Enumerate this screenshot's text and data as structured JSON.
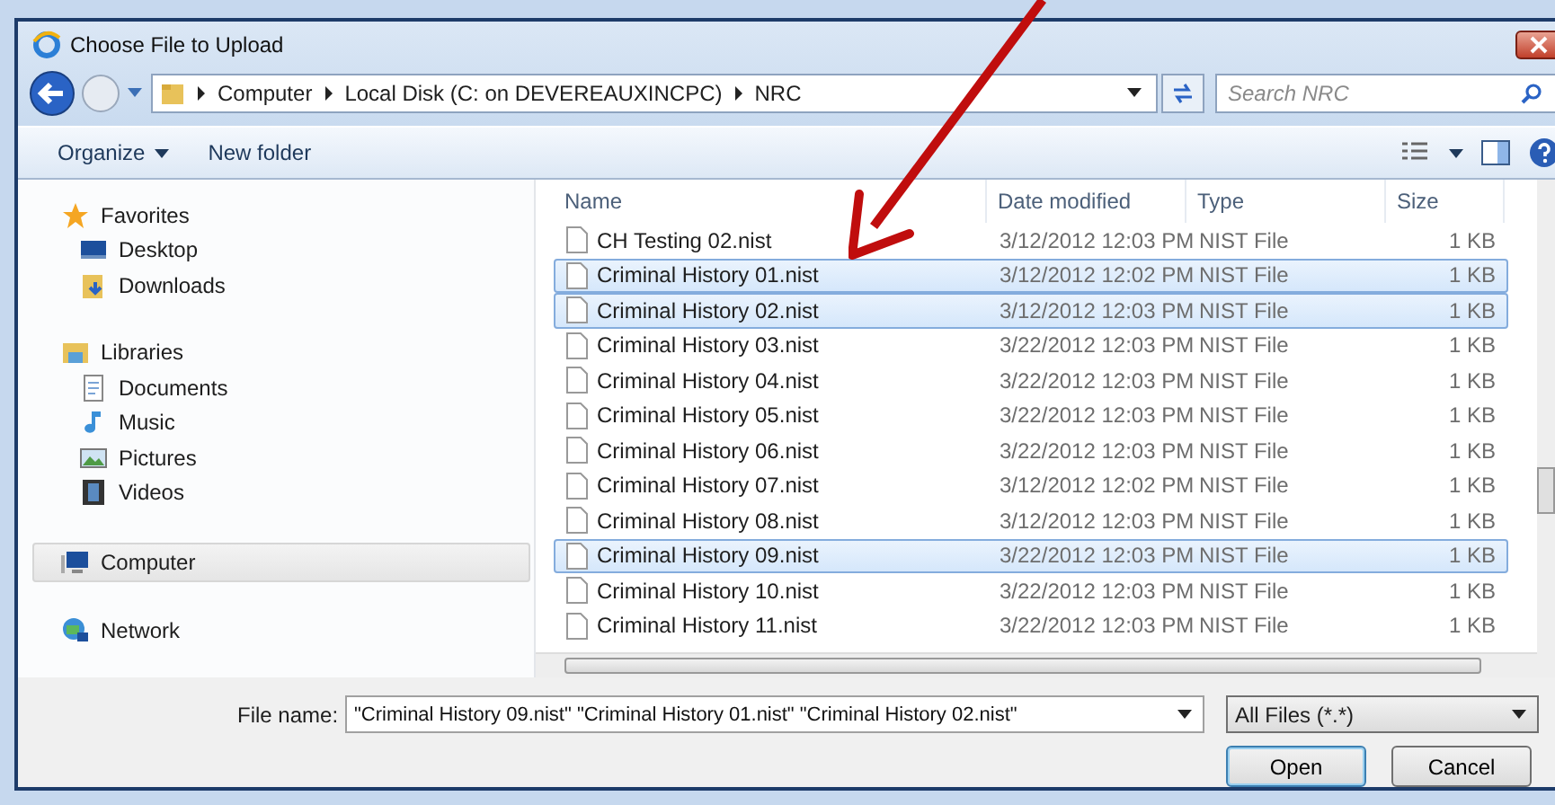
{
  "window": {
    "title": "Choose File to Upload"
  },
  "address_bar": {
    "path": [
      "Computer",
      "Local Disk (C: on DEVEREAUXINCPC)",
      "NRC"
    ]
  },
  "search": {
    "placeholder": "Search NRC"
  },
  "toolbar": {
    "organize": "Organize",
    "new_folder": "New folder"
  },
  "sidebar": {
    "sections": [
      {
        "label": "Favorites",
        "kind": "favorites",
        "selected": false,
        "items": [
          {
            "label": "Desktop",
            "kind": "desktop"
          },
          {
            "label": "Downloads",
            "kind": "downloads"
          }
        ]
      },
      {
        "label": "Libraries",
        "kind": "libraries",
        "selected": false,
        "items": [
          {
            "label": "Documents",
            "kind": "documents"
          },
          {
            "label": "Music",
            "kind": "music"
          },
          {
            "label": "Pictures",
            "kind": "pictures"
          },
          {
            "label": "Videos",
            "kind": "videos"
          }
        ]
      },
      {
        "label": "Computer",
        "kind": "computer",
        "selected": true
      },
      {
        "label": "Network",
        "kind": "network",
        "selected": false
      }
    ]
  },
  "table": {
    "columns": [
      "Name",
      "Date modified",
      "Type",
      "Size"
    ],
    "rows": [
      {
        "name": "CH Testing  02.nist",
        "date": "3/12/2012 12:03 PM",
        "type": "NIST File",
        "size": "1 KB",
        "selected": false
      },
      {
        "name": "Criminal History 01.nist",
        "date": "3/12/2012 12:02 PM",
        "type": "NIST File",
        "size": "1 KB",
        "selected": true
      },
      {
        "name": "Criminal History 02.nist",
        "date": "3/12/2012 12:03 PM",
        "type": "NIST File",
        "size": "1 KB",
        "selected": true
      },
      {
        "name": "Criminal History 03.nist",
        "date": "3/22/2012 12:03 PM",
        "type": "NIST File",
        "size": "1 KB",
        "selected": false
      },
      {
        "name": "Criminal History 04.nist",
        "date": "3/22/2012 12:03 PM",
        "type": "NIST File",
        "size": "1 KB",
        "selected": false
      },
      {
        "name": "Criminal History 05.nist",
        "date": "3/22/2012 12:03 PM",
        "type": "NIST File",
        "size": "1 KB",
        "selected": false
      },
      {
        "name": "Criminal History 06.nist",
        "date": "3/22/2012 12:03 PM",
        "type": "NIST File",
        "size": "1 KB",
        "selected": false
      },
      {
        "name": "Criminal History 07.nist",
        "date": "3/12/2012 12:02 PM",
        "type": "NIST File",
        "size": "1 KB",
        "selected": false
      },
      {
        "name": "Criminal History 08.nist",
        "date": "3/12/2012 12:03 PM",
        "type": "NIST File",
        "size": "1 KB",
        "selected": false
      },
      {
        "name": "Criminal History 09.nist",
        "date": "3/22/2012 12:03 PM",
        "type": "NIST File",
        "size": "1 KB",
        "selected": true
      },
      {
        "name": "Criminal History 10.nist",
        "date": "3/22/2012 12:03 PM",
        "type": "NIST File",
        "size": "1 KB",
        "selected": false
      },
      {
        "name": "Criminal History 11.nist",
        "date": "3/22/2012 12:03 PM",
        "type": "NIST File",
        "size": "1 KB",
        "selected": false
      }
    ]
  },
  "file_name": {
    "label": "File name:",
    "value": "\"Criminal History 09.nist\" \"Criminal History 01.nist\" \"Criminal History 02.nist\""
  },
  "file_type": {
    "value": "All Files (*.*)"
  },
  "buttons": [
    "Open",
    "Cancel"
  ]
}
